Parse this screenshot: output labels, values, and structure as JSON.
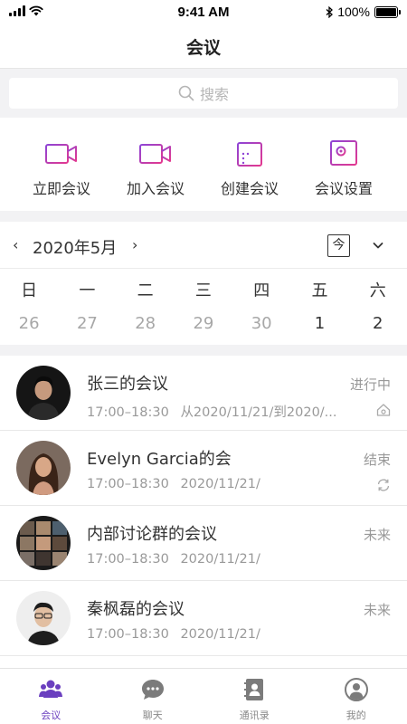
{
  "status_bar": {
    "time": "9:41 AM",
    "battery": "100%",
    "battery_level": 1.0
  },
  "nav": {
    "title": "会议"
  },
  "search": {
    "placeholder": "搜索"
  },
  "actions": [
    {
      "label": "立即会议",
      "icon": "video-camera-icon"
    },
    {
      "label": "加入会议",
      "icon": "join-meeting-icon"
    },
    {
      "label": "创建会议",
      "icon": "calendar-add-icon"
    },
    {
      "label": "会议设置",
      "icon": "settings-icon"
    }
  ],
  "calendar": {
    "prev": "‹",
    "month": "2020年5月",
    "next": "›",
    "today": "今",
    "weekdays": [
      "日",
      "一",
      "二",
      "三",
      "四",
      "五",
      "六"
    ],
    "dates": [
      "26",
      "27",
      "28",
      "29",
      "30",
      "1",
      "2"
    ]
  },
  "meetings": [
    {
      "title": "张三的会议",
      "time": "17:00–18:30",
      "date": "从2020/11/21/到2020/...",
      "status": "进行中",
      "status_icon": "home-icon"
    },
    {
      "title": "Evelyn Garcia的会",
      "time": "17:00–18:30",
      "date": "2020/11/21/",
      "status": "结束",
      "status_icon": "repeat-icon"
    },
    {
      "title": "内部讨论群的会议",
      "time": "17:00–18:30",
      "date": "2020/11/21/",
      "status": "未来"
    },
    {
      "title": "秦枫磊的会议",
      "time": "17:00–18:30",
      "date": "2020/11/21/",
      "status": "未来"
    }
  ],
  "tabs": [
    {
      "label": "会议",
      "icon": "people-icon",
      "active": true
    },
    {
      "label": "聊天",
      "icon": "chat-bubble-icon",
      "active": false
    },
    {
      "label": "通讯录",
      "icon": "contacts-icon",
      "active": false
    },
    {
      "label": "我的",
      "icon": "profile-icon",
      "active": false
    }
  ],
  "colors": {
    "accent": "#6a3fbf",
    "accent_gradient_start": "#8e44d6",
    "accent_gradient_end": "#e3388f",
    "background_strip": "#f2f2f4"
  }
}
